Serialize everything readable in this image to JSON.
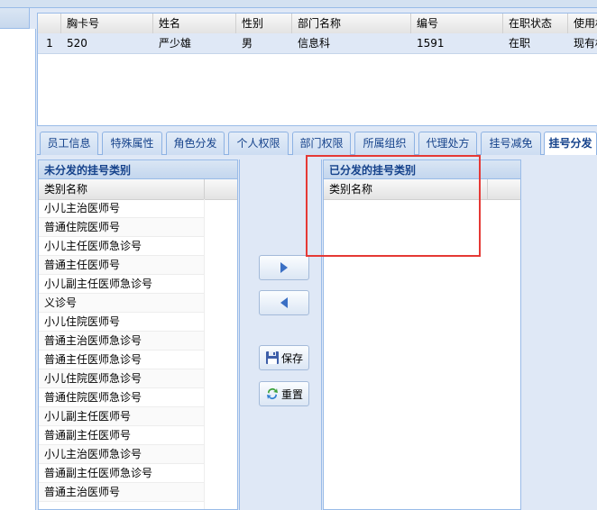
{
  "employee_grid": {
    "columns": [
      "",
      "胸卡号",
      "姓名",
      "性别",
      "部门名称",
      "编号",
      "在职状态",
      "使用权"
    ],
    "rows": [
      [
        "1",
        "520",
        "严少雄",
        "男",
        "信息科",
        "1591",
        "在职",
        "现有权"
      ]
    ]
  },
  "tabs": [
    {
      "label": "员工信息",
      "active": false
    },
    {
      "label": "特殊属性",
      "active": false
    },
    {
      "label": "角色分发",
      "active": false
    },
    {
      "label": "个人权限",
      "active": false
    },
    {
      "label": "部门权限",
      "active": false
    },
    {
      "label": "所属组织",
      "active": false
    },
    {
      "label": "代理处方",
      "active": false
    },
    {
      "label": "挂号减免",
      "active": false
    },
    {
      "label": "挂号分发",
      "active": true
    }
  ],
  "unassigned": {
    "title": "未分发的挂号类别",
    "column": "类别名称",
    "items": [
      "小儿主治医师号",
      "普通住院医师号",
      "小儿主任医师急诊号",
      "普通主任医师号",
      "小儿副主任医师急诊号",
      "义诊号",
      "小儿住院医师号",
      "普通主治医师急诊号",
      "普通主任医师急诊号",
      "小儿住院医师急诊号",
      "普通住院医师急诊号",
      "小儿副主任医师号",
      "普通副主任医师号",
      "小儿主治医师急诊号",
      "普通副主任医师急诊号",
      "普通主治医师号"
    ]
  },
  "assigned": {
    "title": "已分发的挂号类别",
    "column": "类别名称",
    "items": []
  },
  "actions": {
    "move_right_icon": "arrow-right-icon",
    "move_left_icon": "arrow-left-icon",
    "save_label": "保存",
    "reset_label": "重置"
  },
  "colors": {
    "accent": "#15428b",
    "border": "#99bbe8",
    "highlight": "#e53935",
    "arrow": "#3a6fc4"
  }
}
